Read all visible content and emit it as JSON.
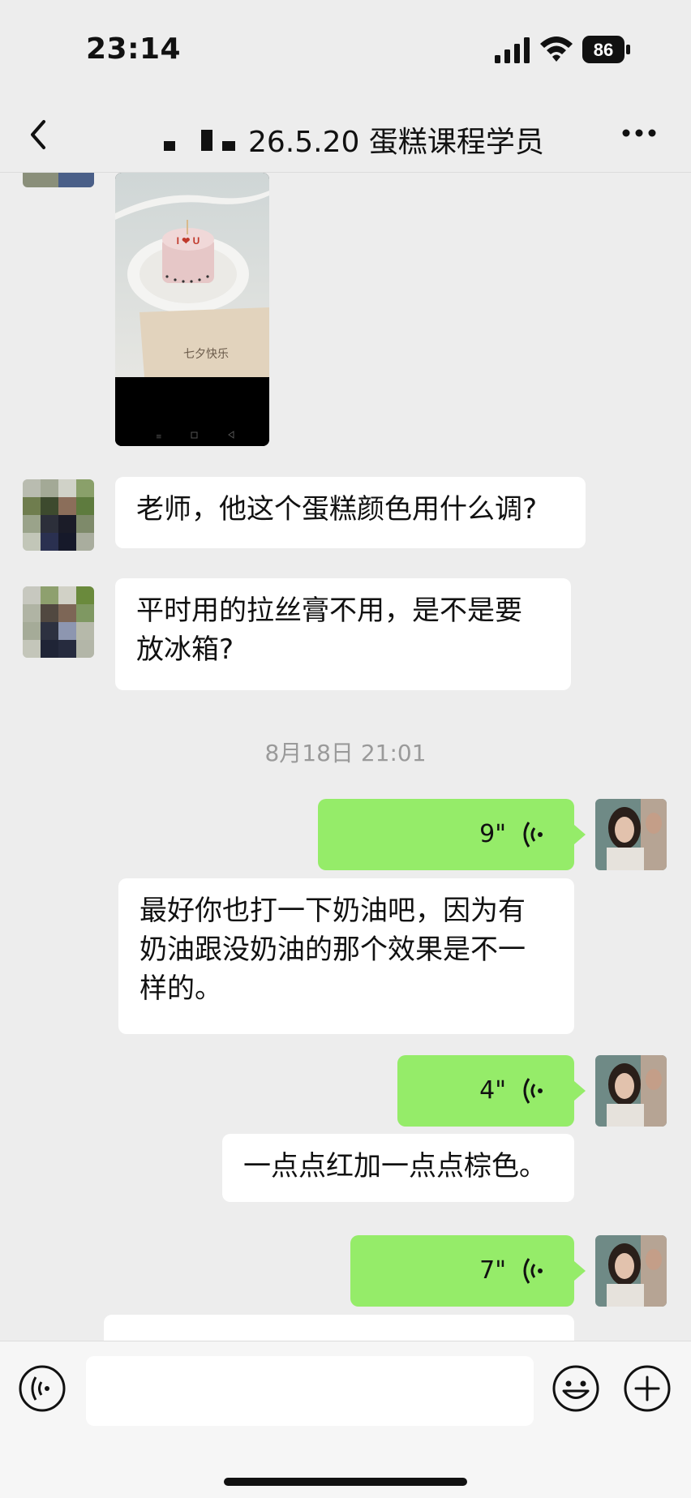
{
  "status_bar": {
    "time": "23:14",
    "battery": "86"
  },
  "header": {
    "title": "26.5.20 蛋糕课程学员"
  },
  "messages": [
    {
      "type": "image",
      "direction": "in",
      "image_caption_text": "七夕快乐",
      "cake_topper_text": "I ❤ U"
    },
    {
      "type": "text",
      "direction": "in",
      "text": "老师，他这个蛋糕颜色用什么调?"
    },
    {
      "type": "text",
      "direction": "in",
      "line1": "平时用的拉丝膏不用，是不是要",
      "line2": "放冰箱?"
    },
    {
      "type": "timestamp",
      "text": "8月18日 21:01"
    },
    {
      "type": "voice",
      "direction": "out",
      "duration": "9\""
    },
    {
      "type": "text",
      "direction": "in",
      "line1": "最好你也打一下奶油吧，因为有",
      "line2": "奶油跟没奶油的那个效果是不一",
      "line3": "样的。"
    },
    {
      "type": "voice",
      "direction": "out",
      "duration": "4\""
    },
    {
      "type": "text",
      "direction": "in",
      "text": "一点点红加一点点棕色。"
    },
    {
      "type": "voice",
      "direction": "out",
      "duration": "7\""
    },
    {
      "type": "text",
      "direction": "in",
      "partial": true,
      "text": ""
    }
  ],
  "colors": {
    "background": "#ededed",
    "bubble_out": "#95ec69",
    "bubble_in": "#ffffff",
    "timestamp": "#9a9a9a"
  },
  "icons": [
    "back-icon",
    "more-icon",
    "voice-mode-icon",
    "emoji-icon",
    "plus-icon",
    "signal-icon",
    "wifi-icon",
    "battery-icon",
    "voice-wave-icon"
  ]
}
